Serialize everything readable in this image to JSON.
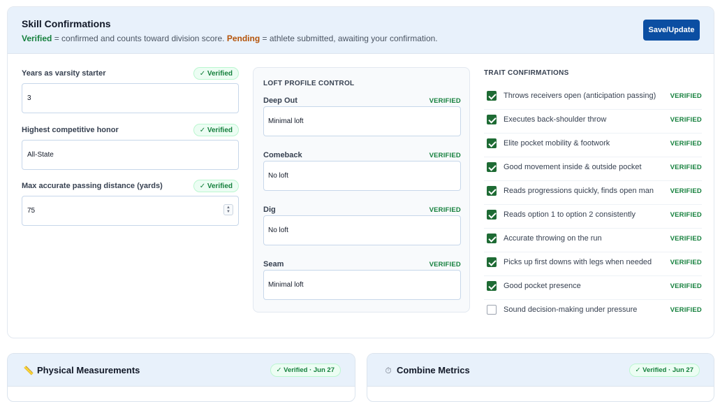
{
  "header": {
    "title": "Skill Confirmations",
    "legend_verified": "Verified",
    "legend_verified_text": " = confirmed and counts toward division score. ",
    "legend_pending": "Pending",
    "legend_pending_text": " = athlete submitted, awaiting your confirmation.",
    "save_label": "Save/Update"
  },
  "fields": [
    {
      "label": "Years as varsity starter",
      "status": "✓ Verified",
      "value": "3"
    },
    {
      "label": "Highest competitive honor",
      "status": "✓ Verified",
      "value": "All-State"
    },
    {
      "label": "Max accurate passing distance (yards)",
      "status": "✓ Verified",
      "value": "75"
    }
  ],
  "loft": {
    "title": "LOFT PROFILE CONTROL",
    "items": [
      {
        "label": "Deep Out",
        "status": "VERIFIED",
        "value": "Minimal loft"
      },
      {
        "label": "Comeback",
        "status": "VERIFIED",
        "value": "No loft"
      },
      {
        "label": "Dig",
        "status": "VERIFIED",
        "value": "No loft"
      },
      {
        "label": "Seam",
        "status": "VERIFIED",
        "value": "Minimal loft"
      }
    ]
  },
  "traits": {
    "title": "TRAIT CONFIRMATIONS",
    "items": [
      {
        "label": "Throws receivers open (anticipation passing)",
        "checked": true,
        "status": "VERIFIED"
      },
      {
        "label": "Executes back-shoulder throw",
        "checked": true,
        "status": "VERIFIED"
      },
      {
        "label": "Elite pocket mobility & footwork",
        "checked": true,
        "status": "VERIFIED"
      },
      {
        "label": "Good movement inside & outside pocket",
        "checked": true,
        "status": "VERIFIED"
      },
      {
        "label": "Reads progressions quickly, finds open man",
        "checked": true,
        "status": "VERIFIED"
      },
      {
        "label": "Reads option 1 to option 2 consistently",
        "checked": true,
        "status": "VERIFIED"
      },
      {
        "label": "Accurate throwing on the run",
        "checked": true,
        "status": "VERIFIED"
      },
      {
        "label": "Picks up first downs with legs when needed",
        "checked": true,
        "status": "VERIFIED"
      },
      {
        "label": "Good pocket presence",
        "checked": true,
        "status": "VERIFIED"
      },
      {
        "label": "Sound decision-making under pressure",
        "checked": false,
        "status": "VERIFIED"
      }
    ]
  },
  "bottom_cards": [
    {
      "title": "Physical Measurements",
      "icon": "ruler-icon",
      "glyph": "📏",
      "status": "✓ Verified · Jun 27"
    },
    {
      "title": "Combine Metrics",
      "icon": "stopwatch-icon",
      "glyph": "⏱",
      "status": "✓ Verified · Jun 27"
    }
  ],
  "colors": {
    "accent": "#0b4ea2",
    "verified": "#15803d",
    "pending": "#b45309",
    "header_bg": "#e8f1fb",
    "checkbox": "#1e6b34"
  }
}
